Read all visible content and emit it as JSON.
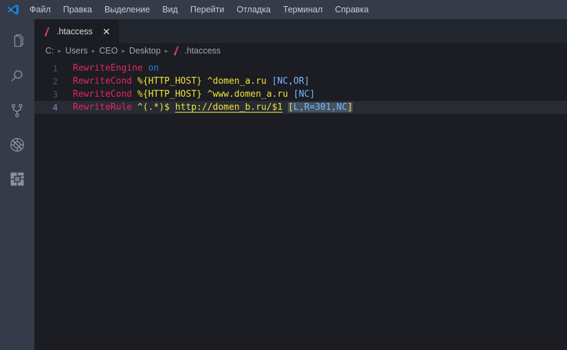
{
  "window": {
    "app_icon": "vscode-logo-icon"
  },
  "menubar": {
    "items": [
      {
        "label": "Файл"
      },
      {
        "label": "Правка"
      },
      {
        "label": "Выделение"
      },
      {
        "label": "Вид"
      },
      {
        "label": "Перейти"
      },
      {
        "label": "Отладка"
      },
      {
        "label": "Терминал"
      },
      {
        "label": "Справка"
      }
    ]
  },
  "activitybar": {
    "items": [
      {
        "name": "explorer",
        "icon": "files-icon"
      },
      {
        "name": "search",
        "icon": "search-icon"
      },
      {
        "name": "source-control",
        "icon": "source-control-branch-icon"
      },
      {
        "name": "run-and-debug",
        "icon": "run-debug-icon"
      },
      {
        "name": "extensions",
        "icon": "extensions-icon"
      }
    ]
  },
  "tabs": [
    {
      "label": ".htaccess",
      "icon": "htaccess-file-icon",
      "close_glyph": "✕",
      "active": true
    }
  ],
  "breadcrumbs": {
    "separator": "▸",
    "items": [
      {
        "label": "C:"
      },
      {
        "label": "Users"
      },
      {
        "label": "CEO"
      },
      {
        "label": "Desktop"
      },
      {
        "label": ".htaccess",
        "icon": "htaccess-file-icon"
      }
    ]
  },
  "editor": {
    "language": "apacheconf",
    "active_line": 4,
    "lines": [
      {
        "number": "1",
        "tokens": [
          {
            "text": "RewriteEngine",
            "style": "t-key"
          },
          {
            "text": " ",
            "style": "t-white"
          },
          {
            "text": "on",
            "style": "t-blue"
          }
        ]
      },
      {
        "number": "2",
        "tokens": [
          {
            "text": "RewriteCond",
            "style": "t-key"
          },
          {
            "text": " ",
            "style": "t-white"
          },
          {
            "text": "%{HTTP_HOST}",
            "style": "t-yel"
          },
          {
            "text": " ",
            "style": "t-white"
          },
          {
            "text": "^domen_a.ru",
            "style": "t-yel"
          },
          {
            "text": " ",
            "style": "t-white"
          },
          {
            "text": "[NC,OR]",
            "style": "t-lblue"
          }
        ]
      },
      {
        "number": "3",
        "tokens": [
          {
            "text": "RewriteCond",
            "style": "t-key"
          },
          {
            "text": " ",
            "style": "t-white"
          },
          {
            "text": "%{HTTP_HOST}",
            "style": "t-yel"
          },
          {
            "text": " ",
            "style": "t-white"
          },
          {
            "text": "^www.domen_a.ru",
            "style": "t-yel"
          },
          {
            "text": " ",
            "style": "t-white"
          },
          {
            "text": "[NC]",
            "style": "t-lblue"
          }
        ]
      },
      {
        "number": "4",
        "tokens": [
          {
            "text": "RewriteRule",
            "style": "t-key"
          },
          {
            "text": " ",
            "style": "t-white"
          },
          {
            "text": "^(.*)$",
            "style": "t-yel"
          },
          {
            "text": " ",
            "style": "t-white"
          },
          {
            "text": "http://domen_b.ru/$1",
            "style": "t-url"
          },
          {
            "text": " ",
            "style": "t-white"
          },
          {
            "text": "[",
            "style": "brkt sel-bg"
          },
          {
            "text": "L,R=301,NC",
            "style": "t-lblue sel-bg"
          },
          {
            "text": "]",
            "style": "brkt sel-bg"
          }
        ]
      }
    ]
  },
  "colors": {
    "chrome": "#353b48",
    "editor_bg": "#1b1d23",
    "tabbar_bg": "#22262e",
    "active_line_bg": "#272b33",
    "keyword": "#e8265f",
    "string": "#f2e33a",
    "flag": "#79b8ff",
    "accent_blue": "#2f7bd6"
  }
}
